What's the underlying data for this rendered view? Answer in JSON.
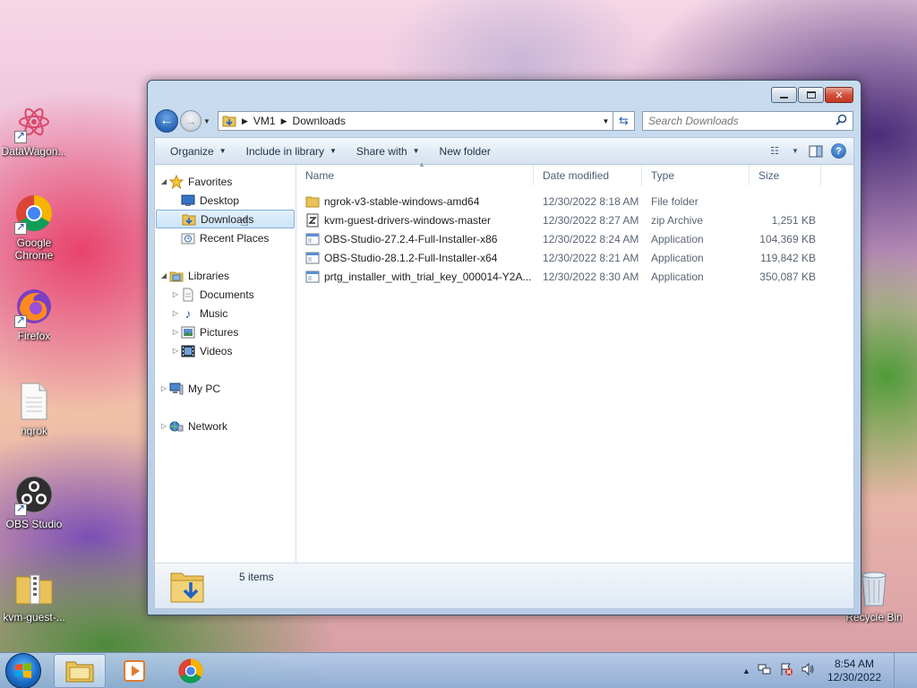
{
  "desktop": {
    "icons": [
      {
        "label": "DataWagon..."
      },
      {
        "label": "Google Chrome"
      },
      {
        "label": "Firefox"
      },
      {
        "label": "ngrok"
      },
      {
        "label": "OBS Studio"
      },
      {
        "label": "kvm-guest-..."
      },
      {
        "label": "Recycle Bin"
      }
    ]
  },
  "window": {
    "address": {
      "crumbs": [
        "VM1",
        "Downloads"
      ]
    },
    "search": {
      "placeholder": "Search Downloads"
    },
    "toolbar": {
      "organize": "Organize",
      "include": "Include in library",
      "share": "Share with",
      "new_folder": "New folder"
    },
    "nav": {
      "favorites": "Favorites",
      "desktop": "Desktop",
      "downloads": "Downloads",
      "recent": "Recent Places",
      "libraries": "Libraries",
      "documents": "Documents",
      "music": "Music",
      "pictures": "Pictures",
      "videos": "Videos",
      "mypc": "My PC",
      "network": "Network"
    },
    "columns": {
      "name": "Name",
      "date": "Date modified",
      "type": "Type",
      "size": "Size"
    },
    "files": [
      {
        "name": "ngrok-v3-stable-windows-amd64",
        "date": "12/30/2022 8:18 AM",
        "type": "File folder",
        "size": "",
        "icon": "folder-icon"
      },
      {
        "name": "kvm-guest-drivers-windows-master",
        "date": "12/30/2022 8:27 AM",
        "type": "zip Archive",
        "size": "1,251 KB",
        "icon": "zip-icon"
      },
      {
        "name": "OBS-Studio-27.2.4-Full-Installer-x86",
        "date": "12/30/2022 8:24 AM",
        "type": "Application",
        "size": "104,369 KB",
        "icon": "app-icon"
      },
      {
        "name": "OBS-Studio-28.1.2-Full-Installer-x64",
        "date": "12/30/2022 8:21 AM",
        "type": "Application",
        "size": "119,842 KB",
        "icon": "app-icon"
      },
      {
        "name": "prtg_installer_with_trial_key_000014-Y2A...",
        "date": "12/30/2022 8:30 AM",
        "type": "Application",
        "size": "350,087 KB",
        "icon": "app-icon"
      }
    ],
    "status": {
      "count": "5 items"
    }
  },
  "taskbar": {
    "clock": {
      "time": "8:54 AM",
      "date": "12/30/2022"
    }
  },
  "colors": {
    "accent": "#2a64b2",
    "selection": "#cce4fa"
  }
}
